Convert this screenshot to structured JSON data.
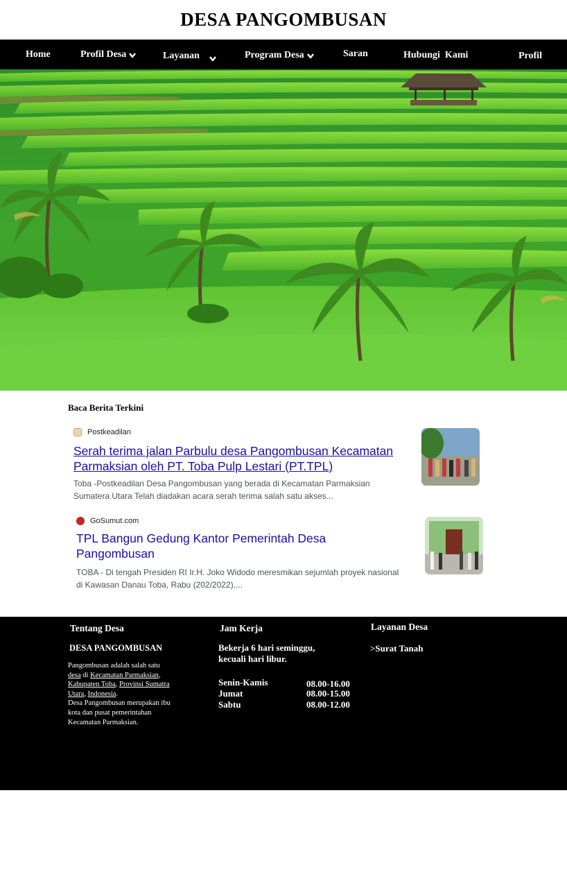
{
  "site": {
    "title": "DESA PANGOMBUSAN"
  },
  "nav": {
    "home": "Home",
    "profil_desa": "Profil Desa",
    "layanan": "Layanan",
    "program_desa": "Program Desa",
    "saran": "Saran",
    "hubungi_kami": "Hubungi  Kami",
    "profil": "Profil"
  },
  "news": {
    "heading": "Baca Berita Terkini",
    "items": [
      {
        "source": "Postkeadilan",
        "title_line1": "Serah terima jalan Parbulu desa Pangombusan Kecamatan",
        "title_line2": "Parmaksian oleh PT. Toba Pulp Lestari (PT.TPL)",
        "snippet_line1": "Toba -Postkeadilan Desa Pangombusan yang berada di Kecamatan Parmaksian",
        "snippet_line2": "Sumatera Utara Telah diadakan acara serah terima salah satu akses..."
      },
      {
        "source": "GoSumut.com",
        "title_line1": "TPL Bangun Gedung Kantor Pemerintah Desa",
        "title_line2": "Pangombusan",
        "snippet_line1": "TOBA - Di tengah Presiden RI Ir.H. Joko Widodo meresmikan sejumlah proyek nasional",
        "snippet_line2": "di Kawasan Danau Toba, Rabu (202/2022),..."
      }
    ]
  },
  "footer": {
    "tentang": {
      "heading": "Tentang Desa",
      "subheading": "DESA PANGOMBUSAN",
      "p1": "Pangombusan adalah salah satu",
      "link_desa": "desa",
      "di": "di",
      "link_kecamatan": "Kecamatan Parmaksian",
      "link_kabupaten": "Kabupaten Toba",
      "link_provinsi_1": "Provinsi Sumatra",
      "link_provinsi_2": "Utara",
      "link_indonesia": "Indonesia",
      "line5": "Desa Pangombusan merupakan ibu",
      "line6": "kota dan pusat pemerintahan",
      "line7": "Kecamatan Parmaksian."
    },
    "jam": {
      "heading": "Jam Kerja",
      "line1": "Bekerja 6 hari seminggu,",
      "line2": "kecuali hari libur.",
      "rows": [
        {
          "day": "Senin-Kamis",
          "time": "08.00-16.00"
        },
        {
          "day": "Jumat",
          "time": "08.00-15.00"
        },
        {
          "day": "Sabtu",
          "time": "08.00-12.00"
        }
      ]
    },
    "layanan": {
      "heading": "Layanan Desa",
      "item1": ">Surat Tanah"
    }
  }
}
